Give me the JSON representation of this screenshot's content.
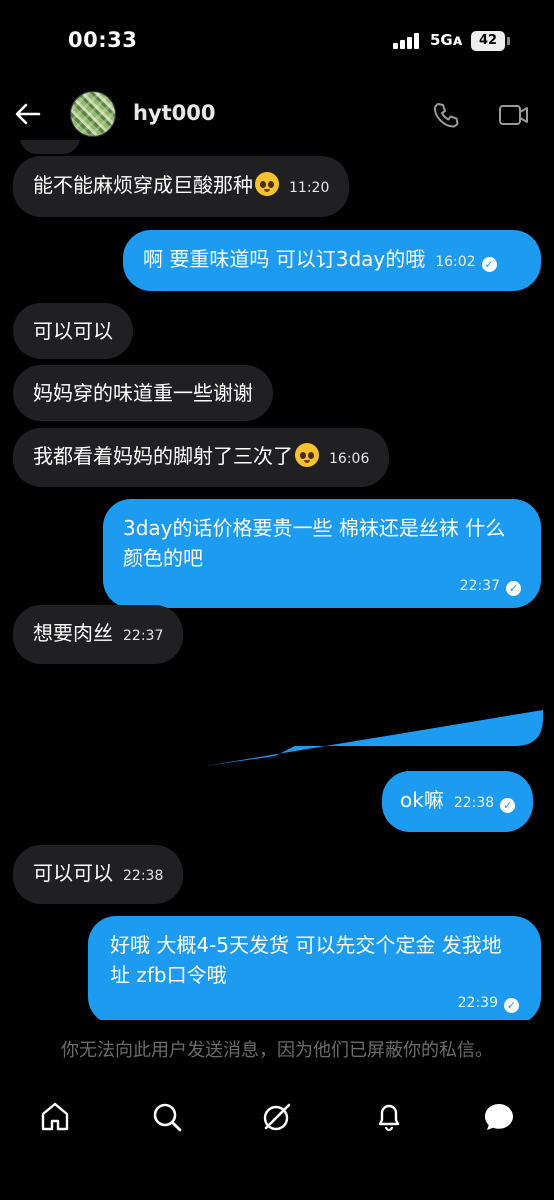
{
  "status_bar": {
    "time": "00:33",
    "network": "5Gᴀ",
    "battery": "42"
  },
  "header": {
    "contact_name": "hyt000",
    "icons": [
      "back-arrow-icon",
      "avatar",
      "phone-icon",
      "video-call-icon"
    ]
  },
  "messages": [
    {
      "direction": "received",
      "text": "能不能麻烦穿成巨酸那种",
      "emoji": "pleading-face-icon",
      "time": "11:20"
    },
    {
      "direction": "sent",
      "text": "啊 要重味道吗 可以订3day的哦",
      "time": "16:02"
    },
    {
      "direction": "received",
      "text": "可以可以"
    },
    {
      "direction": "received",
      "text": "妈妈穿的味道重一些谢谢"
    },
    {
      "direction": "received",
      "text": "我都看着妈妈的脚射了三次了",
      "emoji": "pleading-face-icon",
      "time": "16:06"
    },
    {
      "direction": "sent",
      "text": "3day的话价格要贵一些 棉袜还是丝袜 什么颜色的吧",
      "time": "22:37"
    },
    {
      "direction": "received",
      "text": "想要肉丝",
      "time": "22:37"
    },
    {
      "direction": "sent",
      "text": "ok嘛",
      "time": "22:38"
    },
    {
      "direction": "received",
      "text": "可以可以",
      "time": "22:38"
    },
    {
      "direction": "sent",
      "text": "好哦 大概4-5天发货 可以先交个定金 发我地址 zfb口令哦",
      "time": "22:39"
    }
  ],
  "blocked_notice": "你无法向此用户发送消息，因为他们已屏蔽你的私信。",
  "bottom_nav": [
    "home-icon",
    "search-icon",
    "grok-icon",
    "notifications-icon",
    "messages-icon"
  ],
  "colors": {
    "sent_bubble": "#1d9bf0",
    "received_bubble": "#202023",
    "background": "#000000"
  }
}
